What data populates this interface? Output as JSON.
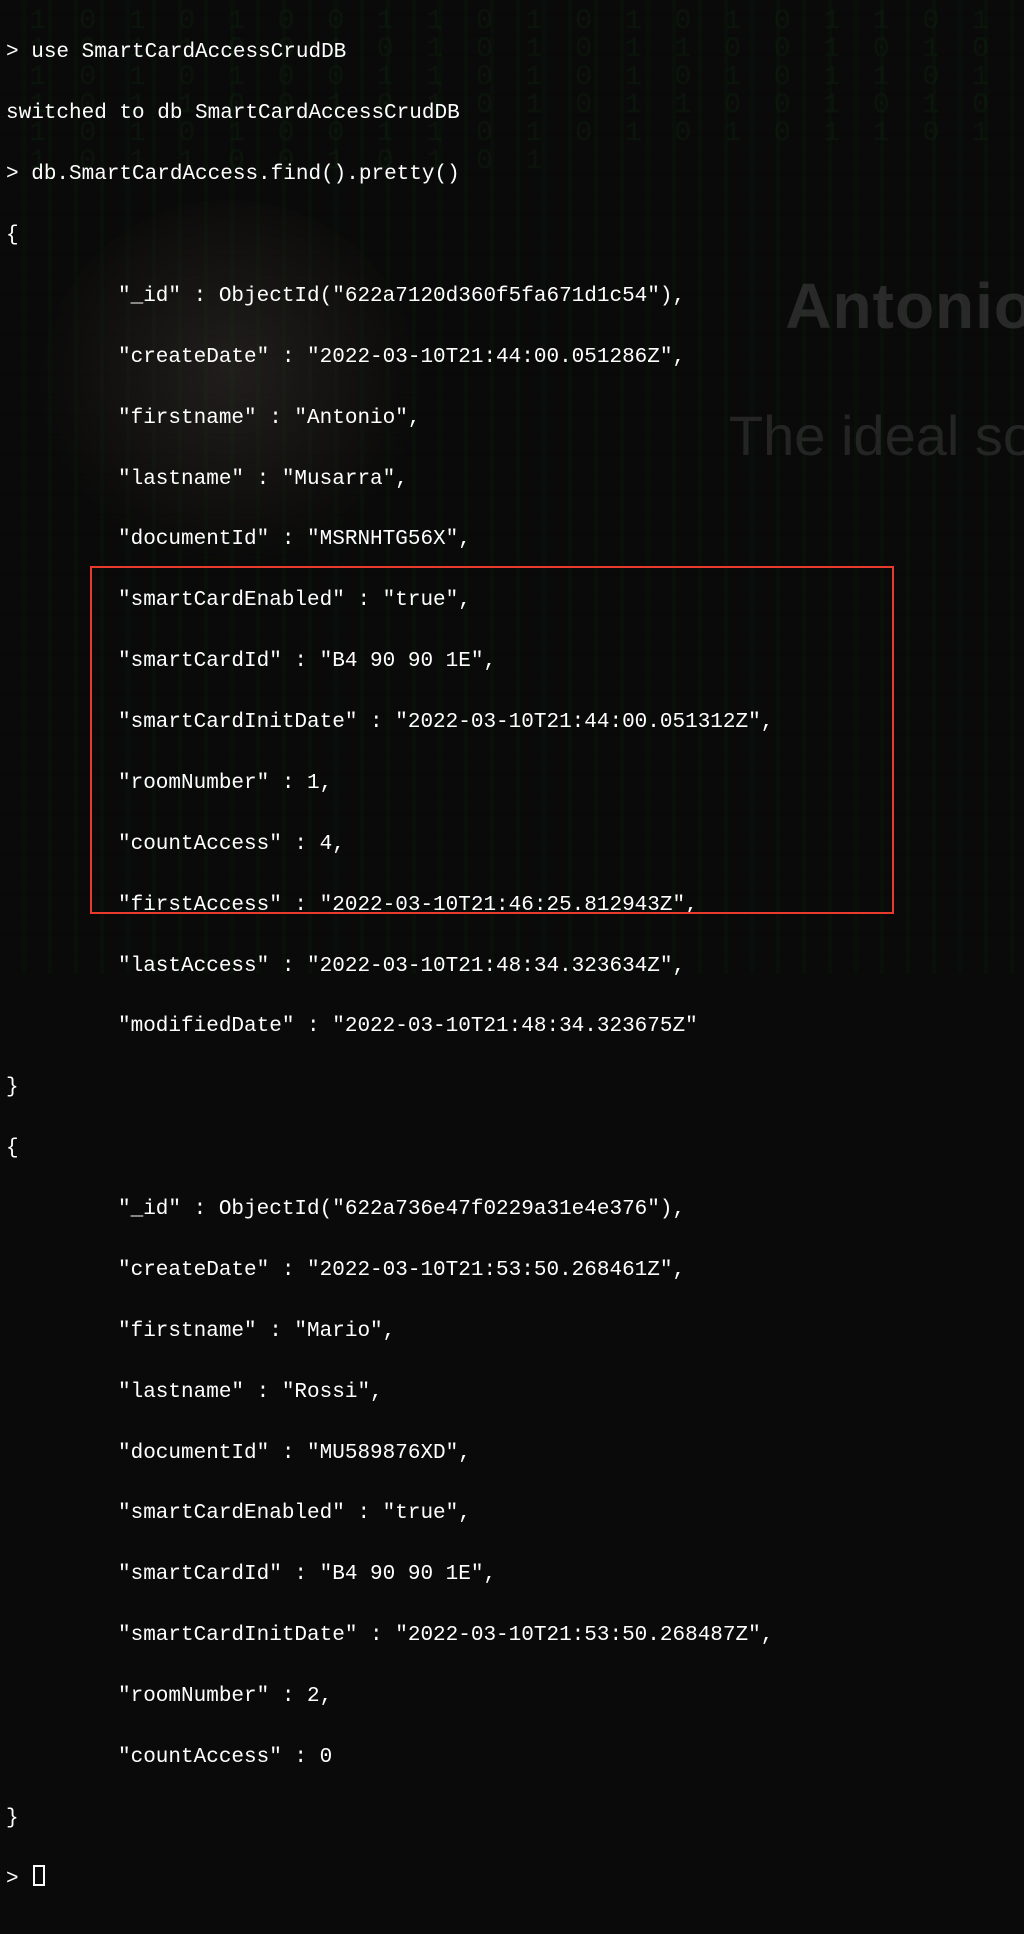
{
  "prompt": ">",
  "cmd_use": "use SmartCardAccessCrudDB",
  "resp_use": "switched to db SmartCardAccessCrudDB",
  "cmd_find": "db.SmartCardAccess.find().pretty()",
  "brace_open": "{",
  "brace_close": "}",
  "brand_name": "Antonio",
  "brand_sub": "The ideal so",
  "highlight_border_color": "#e83b2e",
  "records": [
    {
      "_id": "\"_id\" : ObjectId(\"622a7120d360f5fa671d1c54\"),",
      "createDate": "\"createDate\" : \"2022-03-10T21:44:00.051286Z\",",
      "firstname": "\"firstname\" : \"Antonio\",",
      "lastname": "\"lastname\" : \"Musarra\",",
      "documentId": "\"documentId\" : \"MSRNHTG56X\",",
      "smartCardEnabled": "\"smartCardEnabled\" : \"true\",",
      "smartCardId": "\"smartCardId\" : \"B4 90 90 1E\",",
      "smartCardInitDate": "\"smartCardInitDate\" : \"2022-03-10T21:44:00.051312Z\",",
      "roomNumber": "\"roomNumber\" : 1,",
      "countAccess": "\"countAccess\" : 4,",
      "firstAccess": "\"firstAccess\" : \"2022-03-10T21:46:25.812943Z\",",
      "lastAccess": "\"lastAccess\" : \"2022-03-10T21:48:34.323634Z\",",
      "modifiedDate": "\"modifiedDate\" : \"2022-03-10T21:48:34.323675Z\""
    },
    {
      "_id": "\"_id\" : ObjectId(\"622a736e47f0229a31e4e376\"),",
      "createDate": "\"createDate\" : \"2022-03-10T21:53:50.268461Z\",",
      "firstname": "\"firstname\" : \"Mario\",",
      "lastname": "\"lastname\" : \"Rossi\",",
      "documentId": "\"documentId\" : \"MU589876XD\",",
      "smartCardEnabled": "\"smartCardEnabled\" : \"true\",",
      "smartCardId": "\"smartCardId\" : \"B4 90 90 1E\",",
      "smartCardInitDate": "\"smartCardInitDate\" : \"2022-03-10T21:53:50.268487Z\",",
      "roomNumber": "\"roomNumber\" : 2,",
      "countAccess": "\"countAccess\" : 0"
    }
  ]
}
